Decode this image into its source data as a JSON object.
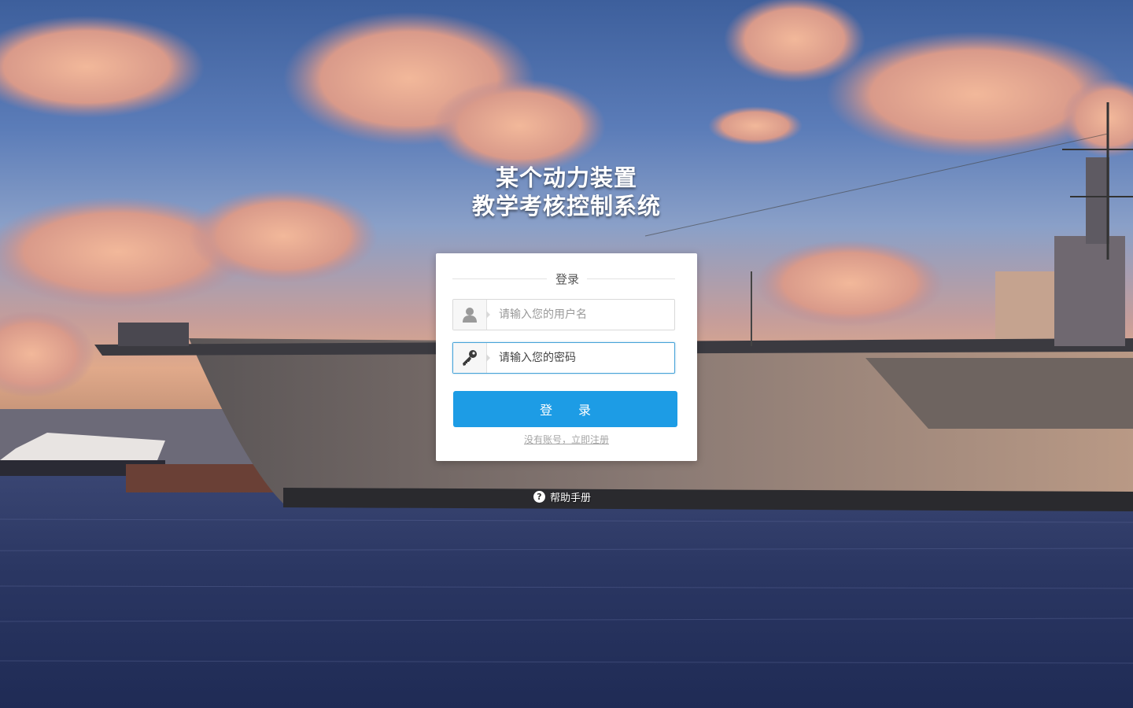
{
  "title": {
    "line1": "某个动力装置",
    "line2": "教学考核控制系统"
  },
  "login_panel": {
    "header": "登录",
    "username": {
      "placeholder": "请输入您的用户名",
      "icon": "user-icon"
    },
    "password": {
      "placeholder": "请输入您的密码",
      "icon": "key-icon"
    },
    "submit_label": "登 录",
    "register_link": "没有账号，立即注册"
  },
  "help": {
    "icon": "question-circle-icon",
    "label": "帮助手册"
  },
  "colors": {
    "primary_button": "#1d9ce5",
    "focus_border": "#47a3d8"
  }
}
